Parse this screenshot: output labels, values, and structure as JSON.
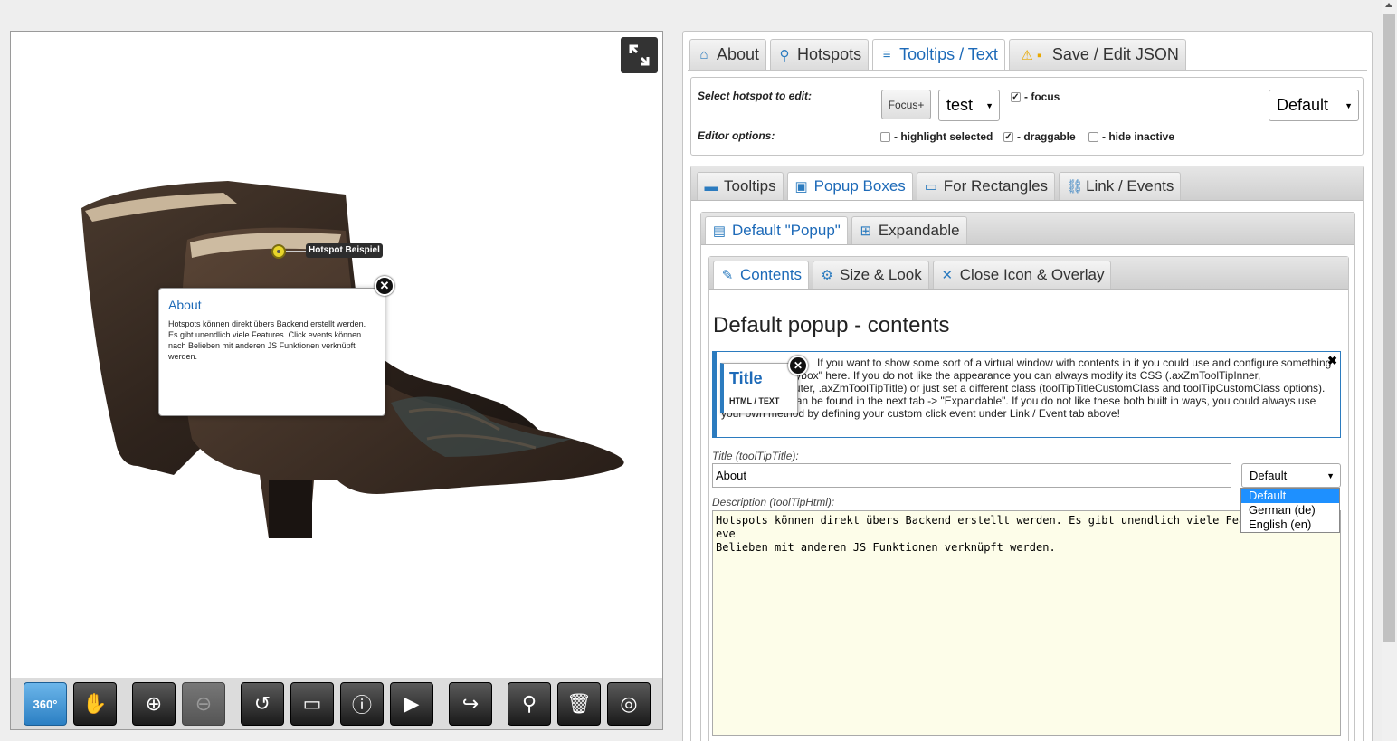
{
  "viewer": {
    "hotspot_label": "Hotspot Beispiel",
    "popup": {
      "title": "About",
      "text": "Hotspots können direkt übers Backend erstellt werden. Es gibt unendlich viele Features. Click events können nach Belieben mit anderen JS Funktionen verknüpft werden.",
      "close": "✕"
    },
    "toolbar": [
      {
        "name": "360",
        "label": "360°",
        "icon": "rotate-360-icon",
        "active": true
      },
      {
        "name": "pan",
        "label": "✋",
        "icon": "hand-icon"
      },
      {
        "name": "zoom-in",
        "label": "⊕",
        "icon": "zoom-in-icon"
      },
      {
        "name": "zoom-out",
        "label": "⊖",
        "icon": "zoom-out-icon",
        "disabled": true
      },
      {
        "name": "reset",
        "label": "↺",
        "icon": "reset-icon"
      },
      {
        "name": "gallery",
        "label": "▭",
        "icon": "gallery-icon"
      },
      {
        "name": "info",
        "label": "ⓘ",
        "icon": "info-pin-icon"
      },
      {
        "name": "play",
        "label": "▶",
        "icon": "play-icon"
      },
      {
        "name": "redo",
        "label": "↪",
        "icon": "redo-icon"
      },
      {
        "name": "add-hotspot",
        "label": "⚲",
        "icon": "add-hotspot-icon"
      },
      {
        "name": "delete",
        "label": "🗑",
        "icon": "trash-icon"
      },
      {
        "name": "target",
        "label": "◎",
        "icon": "target-icon"
      }
    ]
  },
  "panel": {
    "main_tabs": [
      {
        "label": "About",
        "icon": "home-icon",
        "glyph": "⌂"
      },
      {
        "label": "Hotspots",
        "icon": "map-pin-icon",
        "glyph": "⚲"
      },
      {
        "label": "Tooltips / Text",
        "icon": "list-icon",
        "glyph": "≡",
        "active": true
      },
      {
        "label": "Save / Edit JSON",
        "icon": "warning-save-icon",
        "glyph": "⚠"
      }
    ],
    "options": {
      "select_label": "Select hotspot to edit:",
      "editor_label": "Editor options:",
      "focus_button": "Focus+",
      "hotspot_value": "test",
      "focus_check": "- focus",
      "default_value": "Default",
      "highlight_selected": "- highlight selected",
      "draggable": "- draggable",
      "hide_inactive": "- hide inactive"
    },
    "sub_tabs": [
      {
        "label": "Tooltips",
        "icon": "comment-icon",
        "glyph": "▬"
      },
      {
        "label": "Popup Boxes",
        "icon": "popup-icon",
        "glyph": "▣",
        "active": true
      },
      {
        "label": "For Rectangles",
        "icon": "rectangle-icon",
        "glyph": "▭"
      },
      {
        "label": "Link / Events",
        "icon": "link-icon",
        "glyph": "⛓"
      }
    ],
    "popup_tabs": [
      {
        "label": "Default \"Popup\"",
        "icon": "window-icon",
        "glyph": "▤",
        "active": true
      },
      {
        "label": "Expandable",
        "icon": "plus-box-icon",
        "glyph": "⊞"
      }
    ],
    "content_tabs": [
      {
        "label": "Contents",
        "icon": "pencil-icon",
        "glyph": "✎",
        "active": true
      },
      {
        "label": "Size & Look",
        "icon": "gear-icon",
        "glyph": "⚙"
      },
      {
        "label": "Close Icon & Overlay",
        "icon": "close-icon",
        "glyph": "✕"
      }
    ],
    "contents": {
      "heading": "Default popup - contents",
      "info_thumb_title": "Title",
      "info_thumb_sub": "HTML / TEXT",
      "info_text": "If you want to show some sort of a virtual window with contents in it you could use and configure something similar to \"Fancybox\" here. If you do not like the appearance you can always modify its CSS (.axZmToolTipInner, .axZmToolTipOuter, .axZmToolTipTitle) or just set a different class (toolTipTitleCustomClass and toolTipCustomClass options). An alternative can be found in the next tab -> \"Expandable\". If you do not like these both built in ways, you could always use your own method by defining your custom click event under Link / Event tab above!",
      "title_label": "Title (toolTipTitle):",
      "title_value": "About",
      "lang_value": "Default",
      "lang_options": [
        "Default",
        "German (de)",
        "English (en)"
      ],
      "desc_label": "Description (toolTipHtml):",
      "desc_value": "Hotspots können direkt übers Backend erstellt werden. Es gibt unendlich viele Features. Click eve\nBelieben mit anderen JS Funktionen verknüpft werden."
    }
  }
}
